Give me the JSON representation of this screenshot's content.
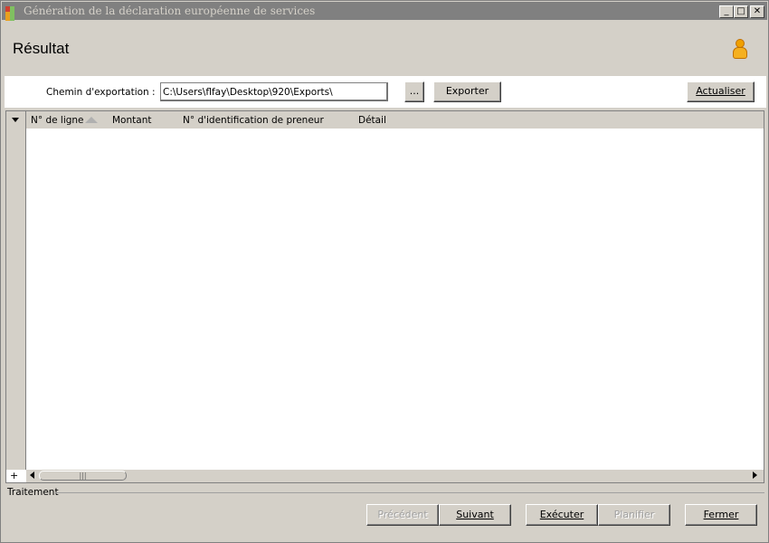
{
  "window": {
    "title": "Génération de la déclaration européenne de services",
    "minimize_label": "_",
    "maximize_label": "□",
    "close_label": "✕"
  },
  "header": {
    "title": "Résultat",
    "icon": "user-icon"
  },
  "toolbar": {
    "path_label": "Chemin d'exportation :",
    "path_value": "C:\\Users\\flfay\\Desktop\\920\\Exports\\",
    "browse_label": "...",
    "export_label": "Exporter",
    "refresh_label": "Actualiser"
  },
  "grid": {
    "columns": [
      "N° de ligne",
      "Montant",
      "N° d'identification de preneur",
      "Détail"
    ],
    "sort_column": "N° de ligne",
    "rows": [],
    "expand_label": "+",
    "scroll_thumb_label": "|||"
  },
  "status": {
    "label": "Traitement"
  },
  "footer": {
    "prev_label": "Précédent",
    "next_label": "Suivant",
    "run_label": "Exécuter",
    "plan_label": "Planifier",
    "close_label": "Fermer"
  }
}
